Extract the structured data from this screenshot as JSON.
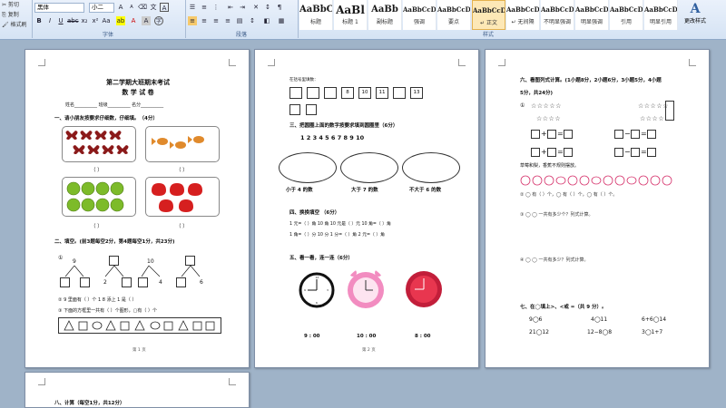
{
  "ribbon": {
    "clipboard": [
      "剪切",
      "复制",
      "格式刷"
    ],
    "font_name": "黑体",
    "font_size": "小二",
    "font_group_label": "字体",
    "paragraph_group_label": "段落",
    "styles_group_label": "样式",
    "styles": [
      {
        "sample": "AaBbC",
        "name": "标题",
        "size": "10px"
      },
      {
        "sample": "AaBl",
        "name": "标题 1",
        "size": "12px"
      },
      {
        "sample": "AaBb",
        "name": "副标题",
        "size": "10px"
      },
      {
        "sample": "AaBbCcD",
        "name": "强调",
        "size": "7px"
      },
      {
        "sample": "AaBbCcD",
        "name": "要点",
        "size": "7px"
      },
      {
        "sample": "AaBbCcD",
        "name": "↵ 正文",
        "size": "7px",
        "active": true
      },
      {
        "sample": "AaBbCcD",
        "name": "↵ 无间隔",
        "size": "7px"
      },
      {
        "sample": "AaBbCcD",
        "name": "不明显强调",
        "size": "7px"
      },
      {
        "sample": "AaBbCcD",
        "name": "明显强调",
        "size": "7px"
      },
      {
        "sample": "AaBbCcD",
        "name": "引用",
        "size": "7px"
      },
      {
        "sample": "AaBbCcD",
        "name": "明显引用",
        "size": "7px"
      }
    ],
    "change_styles": "更改样式"
  },
  "page1": {
    "title": "第二学期大班期末考试",
    "subtitle": "数 学 试 卷",
    "info": "姓名__________    班级__________    名分__________",
    "q1": "一、请小朋友按要求仔细数，仔细填。（4分）",
    "paren": "（      ）",
    "q2": "二、填空。(前3题每空2分，第4题每空1分，共23分)",
    "q2_item1": "①",
    "numbers": [
      "9",
      "10"
    ],
    "leaf_numbers": [
      "2",
      "4",
      "6"
    ],
    "q2_item2": "② 9 里面有（    ）个 1          8 添上 1 是（    ）",
    "q2_item3": "③ 下面的方框里一共有（    ）个图形，▢有（    ）个",
    "page_num": "第 1 页"
  },
  "page2": {
    "top_label": "在括号里填数：",
    "row1": [
      "",
      "",
      "",
      "8",
      "10",
      "11",
      "",
      "13"
    ],
    "q3": "三、把圆圈上面的数字按要求填到圆圈里（6分）",
    "digits": "1   2   3   4   5   6   7   8       9   10",
    "ellipse_labels": [
      "小于 4 的数",
      "大于 7 的数",
      "不大于 6 的数"
    ],
    "q4": "四、换换填空  （6分）",
    "conv_rows": [
      "1 元=（   ）角          10 角 10 元是（   ）元          10 角=（   ）角",
      "1 角=（   ）分          10 分 1 分=（   ）角          2 元=（   ）角"
    ],
    "q5": "五、看一看，连一连（6分）",
    "times": [
      "9 : 00",
      "10 : 00",
      "8 : 00"
    ],
    "page_num": "第 2 页"
  },
  "page3": {
    "q6_l1": "六、看图列式计算。(1小题8分，2小题6分，3小题5分，4小题",
    "q6_l2": "5分，共24分)",
    "q6_item1": "①",
    "stars": "☆☆☆☆☆",
    "stars_right": "☆☆☆☆",
    "plus": "+",
    "minus": "−",
    "eq": "=",
    "fruit_caption": "草莓和梨，香蕉不规则摆放。",
    "q6_item2": "② ◯ 有（    ）个，◯ 有（    ）个，◯ 有（    ）个。",
    "q6_item3": "③ ◯ ◯ 一共有多少个？列式计算。",
    "q6_item4": "④ ◯ ◯ 一共有多少？列式计算。",
    "q7": "七、在◯填上>、<或 =（共 9 分）。",
    "compare": [
      [
        "9◯6",
        "4◯11",
        "6+6◯14"
      ],
      [
        "21◯12",
        "12−8◯8",
        "3◯1+7"
      ]
    ]
  },
  "page4": {
    "q8": "八、计算（每空1分，共12分）"
  }
}
